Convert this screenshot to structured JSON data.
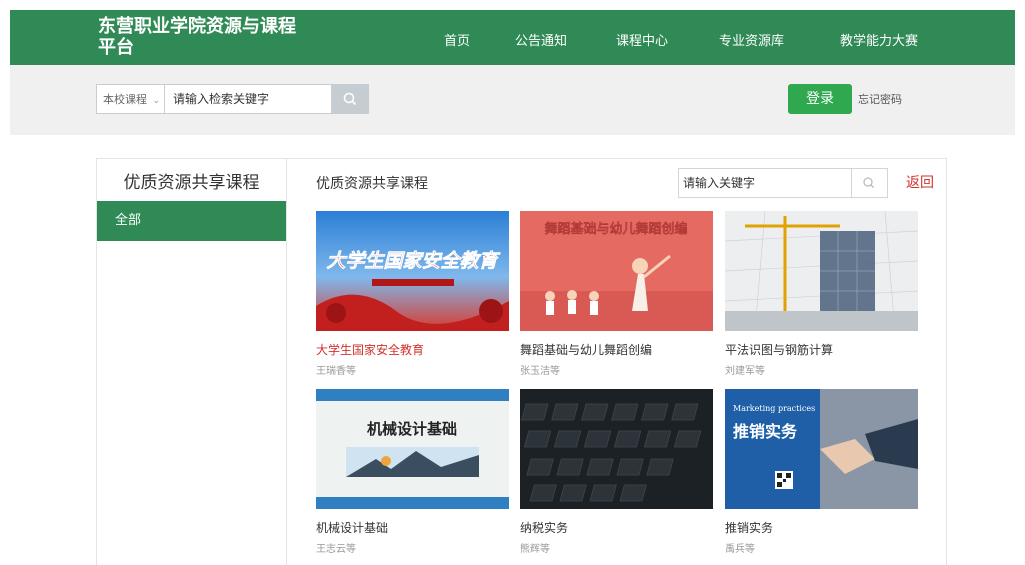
{
  "header": {
    "site_title": "东营职业学院资源与课程平台",
    "nav": [
      "首页",
      "公告通知",
      "课程中心",
      "专业资源库",
      "教学能力大赛"
    ]
  },
  "search": {
    "scope": "本校课程",
    "placeholder": "请输入检索关键字",
    "login_label": "登录",
    "forgot_label": "忘记密码"
  },
  "sidebar": {
    "title": "优质资源共享课程",
    "items": [
      "全部"
    ]
  },
  "main": {
    "title": "优质资源共享课程",
    "keyword_placeholder": "请输入关键字",
    "back_label": "返回"
  },
  "courses": [
    {
      "name": "大学生国家安全教育",
      "author": "王瑞香等",
      "cover_text": "大学生国家安全教育",
      "highlight": true
    },
    {
      "name": "舞蹈基础与幼儿舞蹈创编",
      "author": "张玉洁等",
      "cover_text": "舞蹈基础与幼儿舞蹈创编"
    },
    {
      "name": "平法识图与钢筋计算",
      "author": "刘建军等"
    },
    {
      "name": "机械设计基础",
      "author": "王志云等",
      "cover_text": "机械设计基础"
    },
    {
      "name": "纳税实务",
      "author": "熊辉等"
    },
    {
      "name": "推销实务",
      "author": "禹兵等",
      "cover_text": "推销实务",
      "cover_subtext": "Marketing practices"
    }
  ],
  "colors": {
    "brand_green": "#2f8a56",
    "login_green": "#2fa84f",
    "accent_red": "#d2322d"
  }
}
